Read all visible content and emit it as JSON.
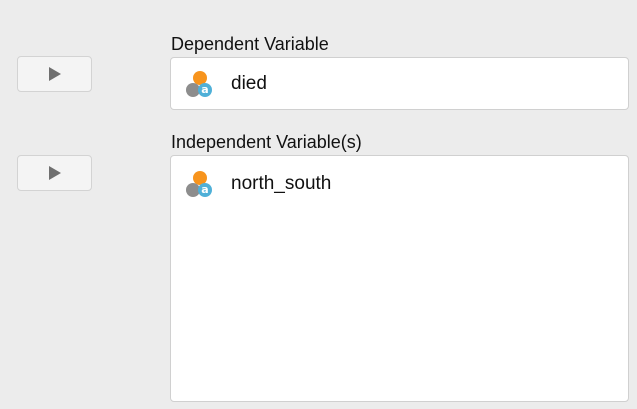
{
  "dependent": {
    "label": "Dependent Variable",
    "variables": [
      {
        "name": "died",
        "icon": "nominal-text-variable-icon",
        "icon_glyph": "a"
      }
    ]
  },
  "independent": {
    "label": "Independent Variable(s)",
    "variables": [
      {
        "name": "north_south",
        "icon": "nominal-text-variable-icon",
        "icon_glyph": "a"
      }
    ]
  },
  "colors": {
    "background": "#ececec",
    "box_background": "#ffffff",
    "icon_orange": "#f7941d",
    "icon_gray": "#8d8d8d",
    "icon_blue": "#4fb0d8",
    "arrow": "#6f6f6f"
  }
}
